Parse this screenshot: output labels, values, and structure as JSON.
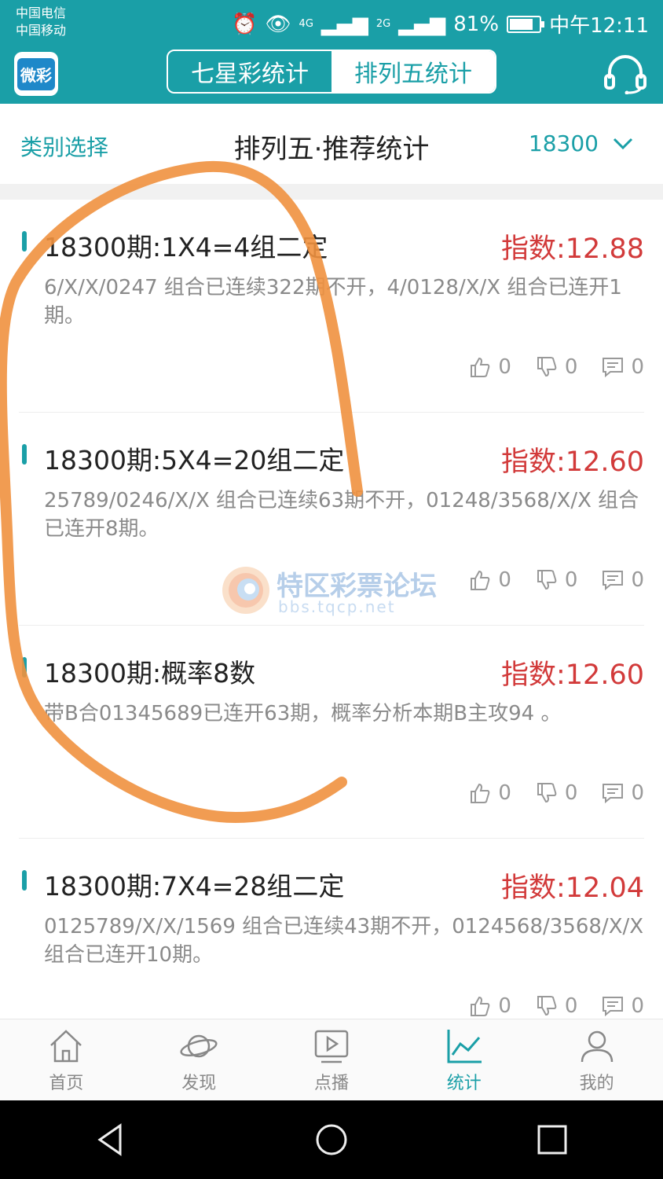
{
  "status_bar": {
    "carrier1": "中国电信",
    "carrier2": "中国移动",
    "net1": "4G",
    "net2": "2G",
    "battery": "81%",
    "battery_level": 0.81,
    "time": "中午12:11"
  },
  "header": {
    "logo_text": "微彩",
    "tabs": [
      {
        "label": "七星彩统计",
        "active": false
      },
      {
        "label": "排列五统计",
        "active": true
      }
    ]
  },
  "subheader": {
    "category_label": "类别选择",
    "title": "排列五·推荐统计",
    "issue": "18300"
  },
  "items": [
    {
      "title": "18300期:1X4=4组二定",
      "index": "指数:12.88",
      "desc": "6/X/X/0247 组合已连续322期不开，4/0128/X/X 组合已连开1期。",
      "likes": "0",
      "dislikes": "0",
      "comments": "0"
    },
    {
      "title": "18300期:5X4=20组二定",
      "index": "指数:12.60",
      "desc": "25789/0246/X/X 组合已连续63期不开，01248/3568/X/X 组合已连开8期。",
      "likes": "0",
      "dislikes": "0",
      "comments": "0"
    },
    {
      "title": "18300期:概率8数",
      "index": "指数:12.60",
      "desc": "带B合01345689已连开63期，概率分析本期B主攻94 。",
      "likes": "0",
      "dislikes": "0",
      "comments": "0"
    },
    {
      "title": "18300期:7X4=28组二定",
      "index": "指数:12.04",
      "desc": "0125789/X/X/1569 组合已连续43期不开，0124568/3568/X/X 组合已连开10期。",
      "likes": "0",
      "dislikes": "0",
      "comments": "0"
    }
  ],
  "watermark": {
    "cn": "特区彩票论坛",
    "en": "bbs.tqcp.net"
  },
  "bottom_nav": [
    {
      "label": "首页",
      "icon": "home-icon",
      "active": false
    },
    {
      "label": "发现",
      "icon": "planet-icon",
      "active": false
    },
    {
      "label": "点播",
      "icon": "play-icon",
      "active": false
    },
    {
      "label": "统计",
      "icon": "chart-icon",
      "active": true
    },
    {
      "label": "我的",
      "icon": "user-icon",
      "active": false
    }
  ],
  "colors": {
    "accent": "#1a9fa7",
    "index_red": "#d23a3a",
    "annotation_orange": "#f0913f"
  }
}
